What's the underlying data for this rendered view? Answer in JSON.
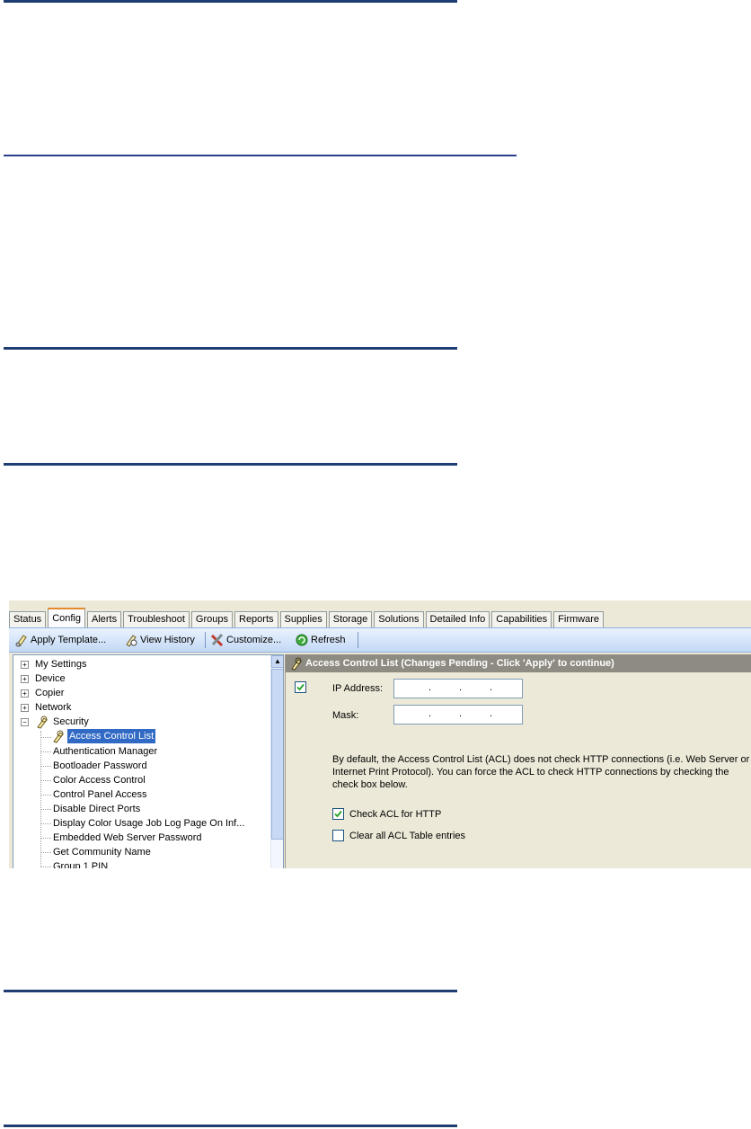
{
  "tabs": [
    "Status",
    "Config",
    "Alerts",
    "Troubleshoot",
    "Groups",
    "Reports",
    "Supplies",
    "Storage",
    "Solutions",
    "Detailed Info",
    "Capabilities",
    "Firmware"
  ],
  "active_tab": "Config",
  "toolbar": {
    "apply_template": "Apply Template...",
    "view_history": "View History",
    "customize": "Customize...",
    "refresh": "Refresh"
  },
  "tree": {
    "top_items": [
      "My Settings",
      "Device",
      "Copier",
      "Network"
    ],
    "security_label": "Security",
    "selected_item": "Access Control List",
    "children": [
      "Authentication Manager",
      "Bootloader Password",
      "Color Access Control",
      "Control Panel Access",
      "Disable Direct Ports",
      "Display Color Usage Job Log Page On Inf...",
      "Embedded Web Server Password",
      "Get Community Name",
      "Group 1 PIN"
    ]
  },
  "panel": {
    "title": "Access Control List (Changes Pending - Click 'Apply' to continue)",
    "ip_label": "IP Address:",
    "mask_label": "Mask:",
    "ip_dots": ".",
    "description": "By default, the Access Control List (ACL) does not check HTTP connections (i.e. Web Server or Internet Print Protocol).  You can force the ACL to check HTTP connections by checking the check box below.",
    "check_acl_http": "Check ACL for HTTP",
    "clear_acl": "Clear all ACL Table entries",
    "row_checkbox_checked": true,
    "check_acl_http_checked": true,
    "clear_acl_checked": false
  },
  "colors": {
    "rule": "#1f3d73",
    "selection": "#316ac5",
    "header": "#8e8b82"
  }
}
